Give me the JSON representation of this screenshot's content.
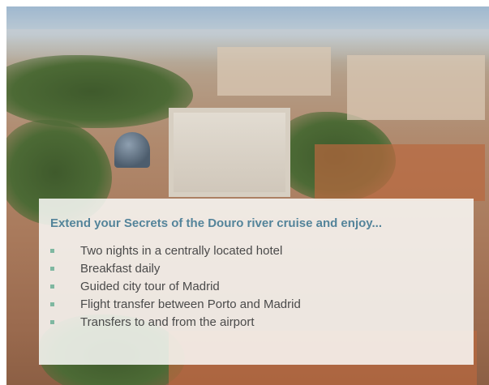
{
  "panel": {
    "title": "Extend your Secrets of the Douro river cruise and enjoy...",
    "bullet_color": "#7fb8a1",
    "title_color": "#54849a",
    "items": [
      "Two nights in a centrally located hotel",
      "Breakfast daily",
      "Guided city tour of Madrid",
      "Flight transfer between Porto and Madrid",
      "Transfers to and from the airport"
    ]
  }
}
